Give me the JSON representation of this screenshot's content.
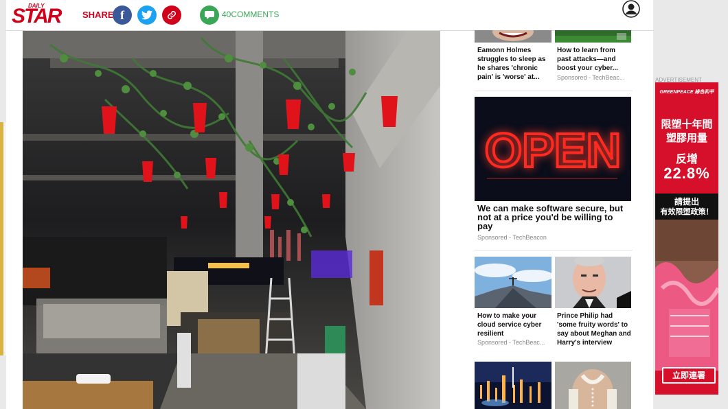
{
  "header": {
    "logo_small": "DAILY",
    "logo_main": "STAR",
    "share_label": "SHARE",
    "comments_count": "40",
    "comments_label": "COMMENTS"
  },
  "sidebar": {
    "top_left": {
      "title": "Eamonn Holmes struggles to sleep as he shares 'chronic pain' is 'worse' at..."
    },
    "top_right": {
      "title": "How to learn from past attacks—and boost your cyber...",
      "sponsor": "Sponsored - TechBeac..."
    },
    "feature": {
      "title": "We can make software secure, but not at a price you'd be willing to pay",
      "sponsor": "Sponsored - TechBeacon",
      "sign_text": "OPEN"
    },
    "mid_left": {
      "title": "How to make your cloud service cyber resilient",
      "sponsor": "Sponsored - TechBeac..."
    },
    "mid_right": {
      "title": "Prince Philip had 'some fruity words' to say about Meghan and Harry's interview"
    }
  },
  "ad": {
    "label": "ADVERTISEMENT",
    "brand": "GREENPEACE 綠色和平",
    "line1": "限塑十年間",
    "line2": "塑膠用量",
    "line3": "反增",
    "percent": "22.8%",
    "line4": "請提出",
    "line5": "有效限塑政策！",
    "cta": "立即連署"
  },
  "colors": {
    "brand": "#d0021b",
    "facebook": "#3b5998",
    "twitter": "#1da1f2",
    "comments": "#3aa757"
  }
}
